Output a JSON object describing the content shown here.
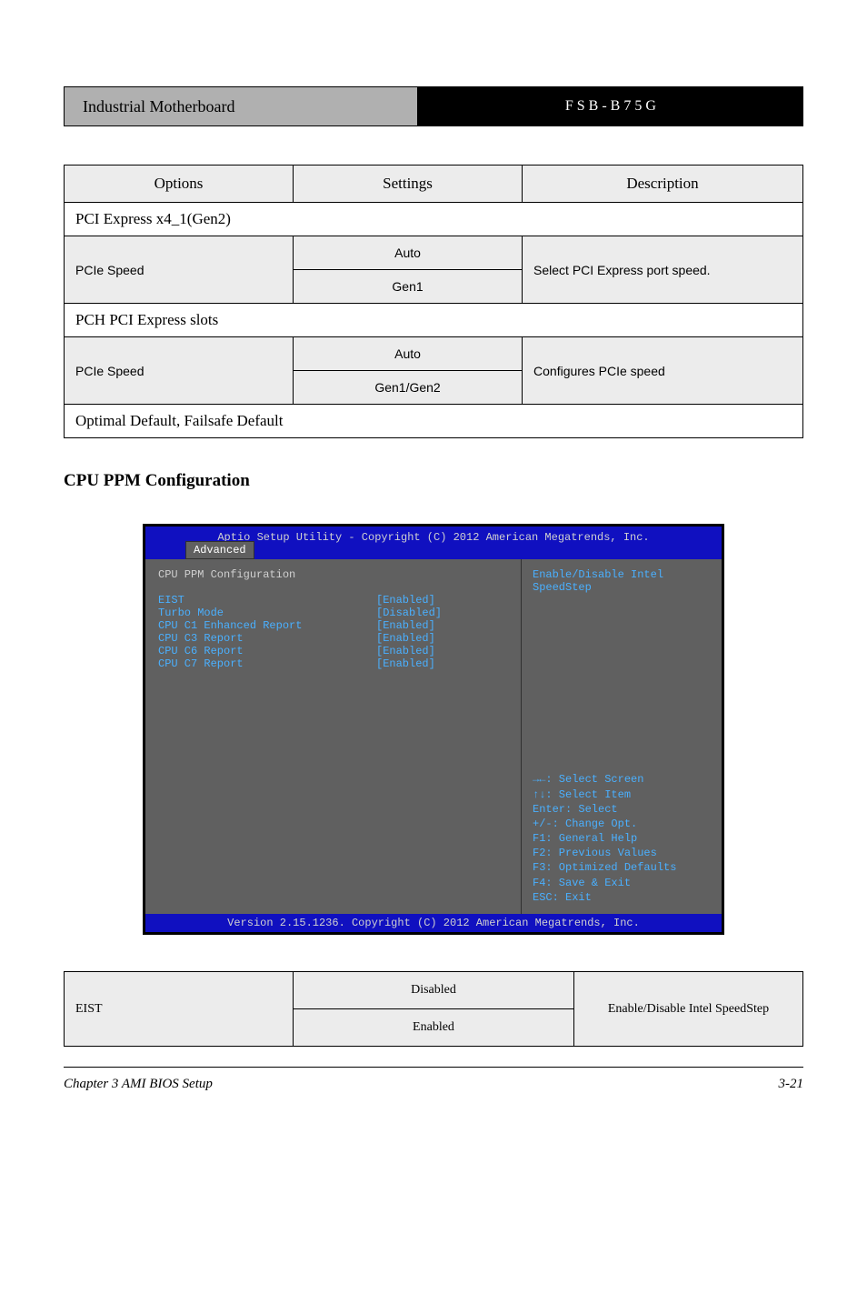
{
  "header": {
    "left": "Industrial Motherboard",
    "right": "F S B - B 7 5 G"
  },
  "optionsTable1": {
    "headers": [
      "Options",
      "Settings",
      "Description"
    ],
    "group1": {
      "title": "PCI Express x4_1(Gen2)",
      "rowLabel": "PCIe Speed",
      "settings": [
        "Auto",
        "Gen1"
      ],
      "desc": "Select PCI Express port speed."
    },
    "group2": {
      "title": "PCH PCI Express slots",
      "rowLabel": "PCIe Speed",
      "settings": [
        "Auto",
        "Gen1/Gen2"
      ],
      "desc": "Configures PCIe speed"
    },
    "footer": "Optimal Default, Failsafe Default"
  },
  "sectionHeading": "CPU PPM Configuration",
  "bios": {
    "topTitle": "Aptio Setup Utility - Copyright (C) 2012 American Megatrends, Inc.",
    "tab": "Advanced",
    "heading": "CPU PPM Configuration",
    "items": [
      {
        "label": "EIST",
        "value": "[Enabled]"
      },
      {
        "label": "Turbo Mode",
        "value": "[Disabled]"
      },
      {
        "label": "CPU C1 Enhanced Report",
        "value": "[Enabled]"
      },
      {
        "label": "CPU C3 Report",
        "value": "[Enabled]"
      },
      {
        "label": "CPU C6 Report",
        "value": "[Enabled]"
      },
      {
        "label": "CPU C7 Report",
        "value": "[Enabled]"
      }
    ],
    "helpTop": "Enable/Disable Intel SpeedStep",
    "keys": [
      "→←: Select Screen",
      "↑↓: Select Item",
      "Enter: Select",
      "+/-: Change Opt.",
      "F1: General Help",
      "F2: Previous Values",
      "F3: Optimized Defaults",
      "F4: Save & Exit",
      "ESC: Exit"
    ],
    "footer": "Version 2.15.1236. Copyright (C) 2012 American Megatrends, Inc."
  },
  "optionsTable2": {
    "rowLabel": "EIST",
    "settings": [
      "Disabled",
      "Enabled"
    ],
    "desc": "Enable/Disable Intel SpeedStep"
  },
  "footer": {
    "left": "Chapter 3 AMI BIOS Setup",
    "right": "3-21"
  }
}
